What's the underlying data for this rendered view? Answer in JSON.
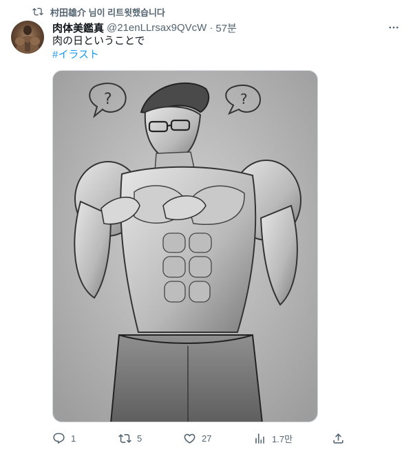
{
  "social_context": {
    "icon": "retweet-icon",
    "text": "村田雄介 님이 리트윗했습니다"
  },
  "tweet": {
    "author_name": "肉体美鑑真",
    "handle": "@21enLLrsax9QVcW",
    "separator": "·",
    "time": "57분",
    "text": "肉の日ということで",
    "hashtag": "#イラスト"
  },
  "actions": {
    "reply_count": "1",
    "retweet_count": "5",
    "like_count": "27",
    "views_count": "1.7만"
  },
  "colors": {
    "link": "#1d9bf0",
    "secondary_text": "#536471",
    "primary_text": "#0f1419"
  }
}
